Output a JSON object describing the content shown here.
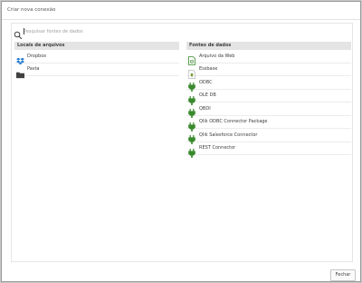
{
  "dialog": {
    "title": "Criar nova conexão"
  },
  "search": {
    "placeholder": "Pesquisar fontes de dados",
    "value": ""
  },
  "file_locations": {
    "header": "Locais de arquivos",
    "items": [
      {
        "label": "Dropbox",
        "icon": "dropbox-icon"
      },
      {
        "label": "Pasta",
        "icon": "folder-icon"
      }
    ]
  },
  "data_sources": {
    "header": "Fontes de dados",
    "items": [
      {
        "label": "Arquivo da Web",
        "icon": "web-file-icon"
      },
      {
        "label": "Essbase",
        "icon": "essbase-icon"
      },
      {
        "label": "ODBC",
        "icon": "connector-plug-icon"
      },
      {
        "label": "OLE DB",
        "icon": "connector-plug-icon"
      },
      {
        "label": "QBDI",
        "icon": "connector-plug-icon"
      },
      {
        "label": "Qlik ODBC Connector Package",
        "icon": "connector-plug-icon"
      },
      {
        "label": "Qlik Salesforce Connector",
        "icon": "connector-plug-icon"
      },
      {
        "label": "REST Connector",
        "icon": "connector-plug-icon"
      }
    ]
  },
  "footer": {
    "close_label": "Fechar"
  },
  "colors": {
    "plug_green": "#3a8a2e",
    "dropbox_blue": "#1e78d2",
    "folder_dark": "#404040"
  }
}
